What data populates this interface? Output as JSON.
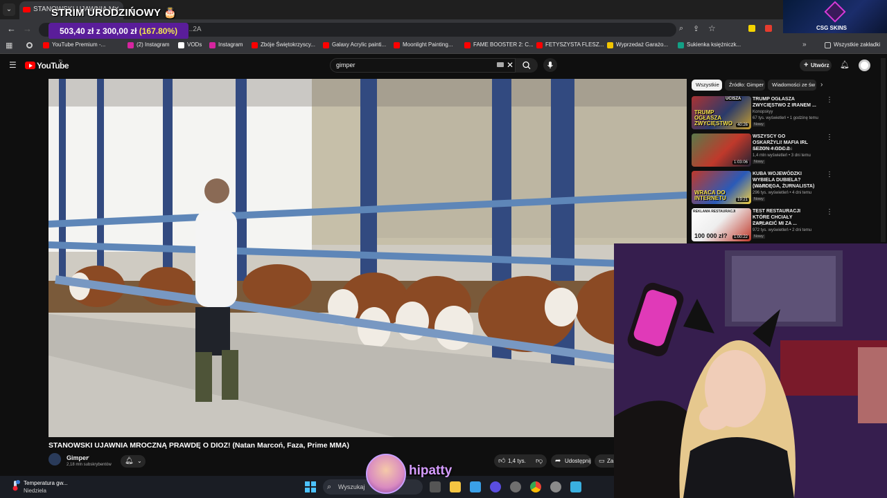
{
  "browser": {
    "tab_title": "STANOWSKI UJAWNIA M...",
    "url": "...2A",
    "bookmarks": [
      {
        "label": "YouTube Premium -...",
        "color": "#ff0000"
      },
      {
        "label": "(2) Instagram",
        "color": "#d6249f"
      },
      {
        "label": "VODs",
        "color": "#ffffff"
      },
      {
        "label": "Instagram",
        "color": "#d6249f"
      },
      {
        "label": "Zbóje Świętokrzyscy...",
        "color": "#ff0000"
      },
      {
        "label": "Galaxy Acrylic painti...",
        "color": "#ff0000"
      },
      {
        "label": "Moonlight Painting...",
        "color": "#ff0000"
      },
      {
        "label": "FAME BOOSTER 2: C...",
        "color": "#ff0000"
      },
      {
        "label": "FETYSZYSTA FLESZ...",
        "color": "#ff0000"
      },
      {
        "label": "Wyprzedaż Garażo...",
        "color": "#f2c500"
      },
      {
        "label": "Sukienka księżniczk...",
        "color": "#12a085"
      }
    ],
    "all_bookmarks": "Wszystkie zakładki"
  },
  "stream_overlay": {
    "title": "STRIM URODZIŃOWY 🎂",
    "goal_current": "503,40 zł z 300,00 zł",
    "goal_percent": "(167.80%)",
    "sponsor": "CSG SKINS",
    "streamer_name": "hipatty"
  },
  "youtube": {
    "logo": "YouTube",
    "logo_region": "PL",
    "search_value": "gimper",
    "create_label": "Utwórz",
    "video": {
      "title": "STANOWSKI UJAWNIA MROCZNĄ PRAWDĘ O DIOZ! (Natan Marcoń, Faza, Prime MMA)",
      "channel": "Gimper",
      "subscribers": "2,18 mln subskrybentów",
      "likes": "1,4 tys.",
      "share": "Udostępnij",
      "save": "Za"
    },
    "chips": [
      "Wszystkie",
      "Źródło: Gimper",
      "Wiadomości ze św"
    ],
    "recommendations": [
      {
        "title": "TRUMP OGŁASZA ZWYCIĘSTWO Z IRANEM ...",
        "channel": "Konopskyy",
        "meta": "67 tys. wyświetleń • 1 godzinę temu",
        "badge": "Nowy",
        "duration": "40:26",
        "thumb_text": "TRUMP OGŁASZA ZWYCIĘSTWO",
        "thumb_top": "UCISZA"
      },
      {
        "title": "WSZYSCY GO OSKARŻYLI! MAFIA IRL SEZON 4 odc.2",
        "channel": "Karol Friz Wiśniewski",
        "meta": "1,4 mln wyświetleń • 3 dni temu",
        "badge": "Nowy",
        "duration": "1:03:06",
        "thumb_text": "",
        "thumb_top": ""
      },
      {
        "title": "KUBA WOJEWÓDZKI WYBIELA DUBIELA? (Wardęga, Żurnalista)",
        "channel": "Gimper",
        "meta": "296 tys. wyświetleń • 4 dni temu",
        "badge": "Nowy",
        "duration": "19:21",
        "thumb_text": "WRACA DO INTERNETU",
        "thumb_top": ""
      },
      {
        "title": "TEST RESTAURACJI KTÓRE CHCIAŁY ZAPŁACIĆ MI ZA ...",
        "channel": "KSIĄŻULO",
        "meta": "972 tys. wyświetleń • 2 dni temu",
        "badge": "Nowy",
        "duration": "1:00:22",
        "thumb_text": "100 000 zł?",
        "thumb_top": "REKLAMA RESTAURACJI"
      }
    ]
  },
  "taskbar": {
    "weather_title": "Temperatura gw...",
    "weather_sub": "Niedziela",
    "search_label": "Wyszukaj"
  }
}
